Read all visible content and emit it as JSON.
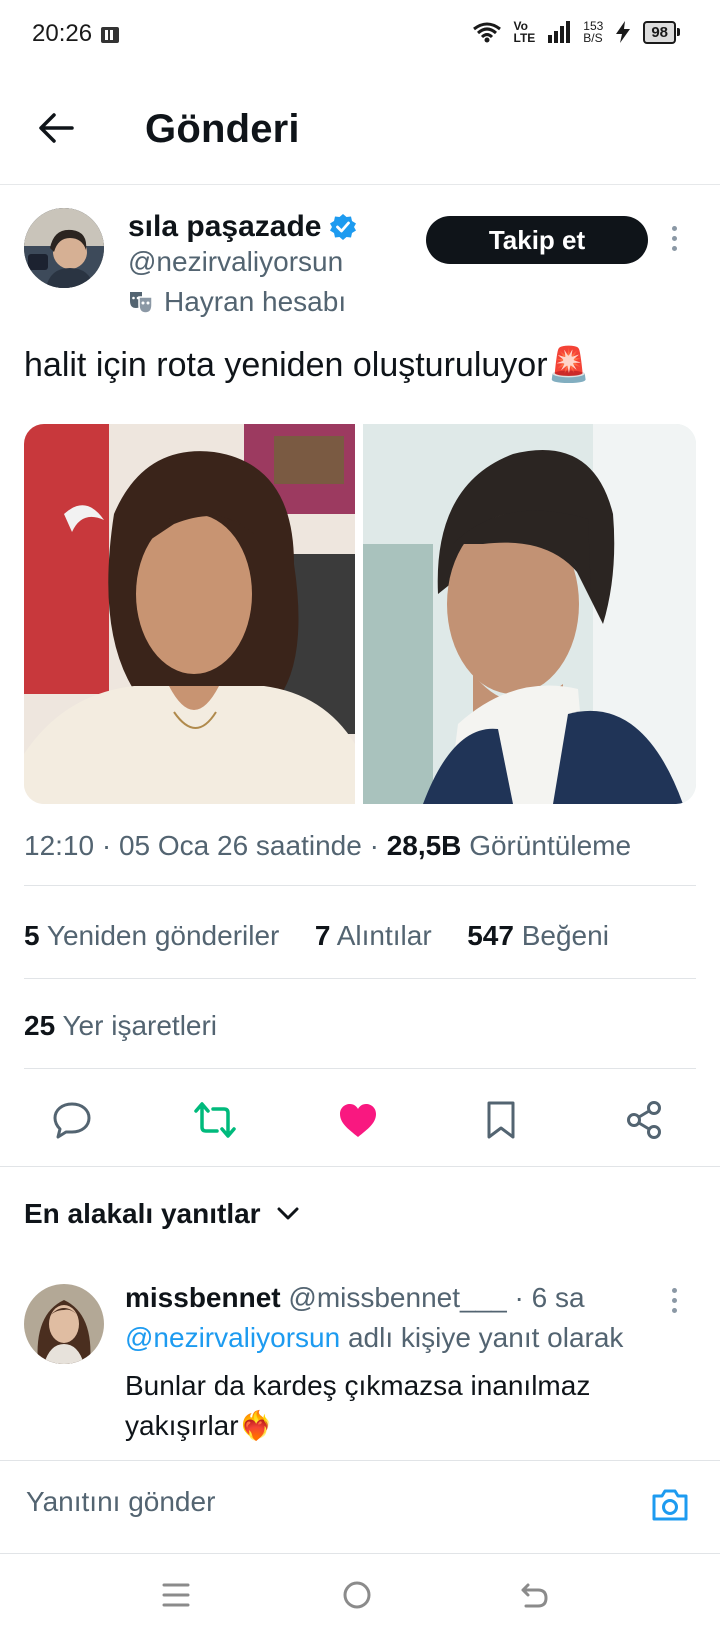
{
  "status_bar": {
    "time": "20:26",
    "network_top": "Vo",
    "network_bottom": "LTE",
    "speed_top": "153",
    "speed_bottom": "B/S",
    "battery": "98"
  },
  "header": {
    "title": "Gönderi",
    "back_icon": "arrow-left-icon"
  },
  "post": {
    "author_name": "sıla paşazade",
    "author_handle": "@nezirvaliyorsun",
    "account_label": "Hayran hesabı",
    "follow_label": "Takip et",
    "text": "halit için rota yeniden oluşturuluyor",
    "emoji": "🚨",
    "time": "12:10 · 05 Oca 26 saatinde · ",
    "views_count": "28,5B",
    "views_label": "Görüntüleme",
    "reposts_count": "5",
    "reposts_label": "Yeniden gönderiler",
    "quotes_count": "7",
    "quotes_label": "Alıntılar",
    "likes_count": "547",
    "likes_label": "Beğeni",
    "bookmarks_count": "25",
    "bookmarks_label": "Yer işaretleri"
  },
  "actions": {
    "reply_icon": "comment-icon",
    "repost_icon": "repost-icon",
    "like_icon": "heart-icon",
    "bookmark_icon": "bookmark-icon",
    "share_icon": "share-icon"
  },
  "replies_section": {
    "label": "En alakalı yanıtlar"
  },
  "reply": {
    "name": "missbennet",
    "handle": "@missbennet___",
    "time": " · 6 sa",
    "reply_to_handle": "@nezirvaliyorsun",
    "reply_to_suffix": " adlı kişiye yanıt olarak",
    "text": "Bunlar da kardeş çıkmazsa inanılmaz yakışırlar",
    "emoji": "❤️‍🔥"
  },
  "composer": {
    "placeholder": "Yanıtını gönder"
  },
  "colors": {
    "accent": "#1d9bf0",
    "repost": "#00ba7c",
    "like": "#f91880",
    "text": "#0f1419",
    "muted": "#536471"
  }
}
